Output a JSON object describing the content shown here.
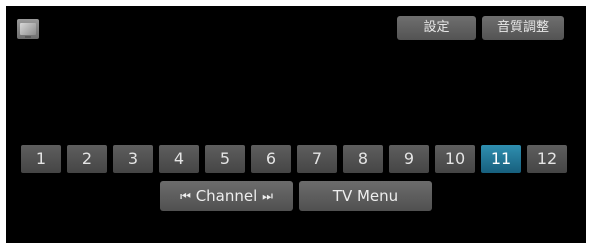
{
  "top_bar": {
    "source_icon": "tv-source-icon",
    "settings_label": "設定",
    "audio_adjust_label": "音質調整"
  },
  "channels": {
    "items": [
      "1",
      "2",
      "3",
      "4",
      "5",
      "6",
      "7",
      "8",
      "9",
      "10",
      "11",
      "12"
    ],
    "selected": "11"
  },
  "bottom_bar": {
    "channel_label": "Channel",
    "channel_prev_icon": "skip-previous-icon",
    "channel_next_icon": "skip-next-icon",
    "tv_menu_label": "TV Menu"
  },
  "colors": {
    "background": "#000000",
    "button": "#5a5a5a",
    "selected": "#1f7596"
  }
}
